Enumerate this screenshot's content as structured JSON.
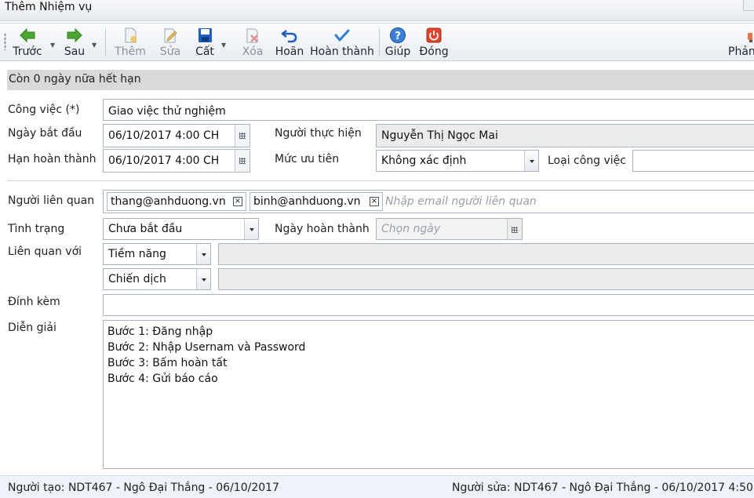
{
  "window": {
    "title": "Thêm Nhiệm vụ"
  },
  "toolbar": {
    "back_label": "Trước",
    "next_label": "Sau",
    "add_label": "Thêm",
    "edit_label": "Sửa",
    "save_label": "Cất",
    "delete_label": "Xóa",
    "undo_label": "Hoãn",
    "complete_label": "Hoàn thành",
    "help_label": "Giúp",
    "close_label": "Đóng",
    "feedback_label": "Phản"
  },
  "banner": {
    "text": "Còn 0 ngày nữa hết hạn"
  },
  "form": {
    "task_label": "Công việc (*)",
    "task_value": "Giao việc thử nghiệm",
    "start_label": "Ngày bắt đầu",
    "start_value": "06/10/2017 4:00 CH",
    "assignee_label": "Người thực hiện",
    "assignee_value": "Nguyễn Thị Ngọc Mai",
    "due_label": "Hạn hoàn thành",
    "due_value": "06/10/2017 4:00 CH",
    "priority_label": "Mức ưu tiên",
    "priority_value": "Không xác định",
    "type_label": "Loại công việc",
    "type_value": "",
    "related_people_label": "Người liên quan",
    "related_people": [
      "thang@anhduong.vn",
      "binh@anhduong.vn"
    ],
    "related_people_placeholder": "Nhập email người liên quan",
    "status_label": "Tình trạng",
    "status_value": "Chưa bắt đầu",
    "completed_date_label": "Ngày hoàn thành",
    "completed_date_placeholder": "Chọn ngày",
    "related_to_label": "Liên quan với",
    "related_to_1": "Tiềm năng",
    "related_to_2": "Chiến dịch",
    "attachment_label": "Đính kèm",
    "description_label": "Diễn giải",
    "description_lines": [
      "Bước 1: Đăng nhập",
      "Bước 2: Nhập Usernam và Password",
      "Bước 3: Bấm hoàn tất",
      "Bước 4: Gửi báo cáo"
    ]
  },
  "footer": {
    "created_by": "Người tạo: NDT467 - Ngô Đại Thắng - 06/10/2017",
    "modified_by": "Người sửa: NDT467 - Ngô Đại Thắng - 06/10/2017 4:50"
  },
  "colors": {
    "banner_bg": "#d9d9d9",
    "readonly_bg": "#ebebeb",
    "footer_bg": "#eef3f9",
    "green_arrow": "#4aa832",
    "blue_icon": "#1f5fbf",
    "close_red": "#e0442c"
  },
  "icons": {
    "back": "arrow-left-icon",
    "next": "arrow-right-icon",
    "add": "new-document-icon",
    "edit": "edit-document-icon",
    "save": "floppy-disk-icon",
    "delete": "delete-document-icon",
    "undo": "undo-icon",
    "complete": "checkmark-icon",
    "help": "help-icon",
    "close": "power-icon",
    "feedback": "feedback-icon",
    "calendar": "calendar-icon",
    "dropdown": "chevron-down-icon",
    "remove_tag": "close-icon"
  }
}
